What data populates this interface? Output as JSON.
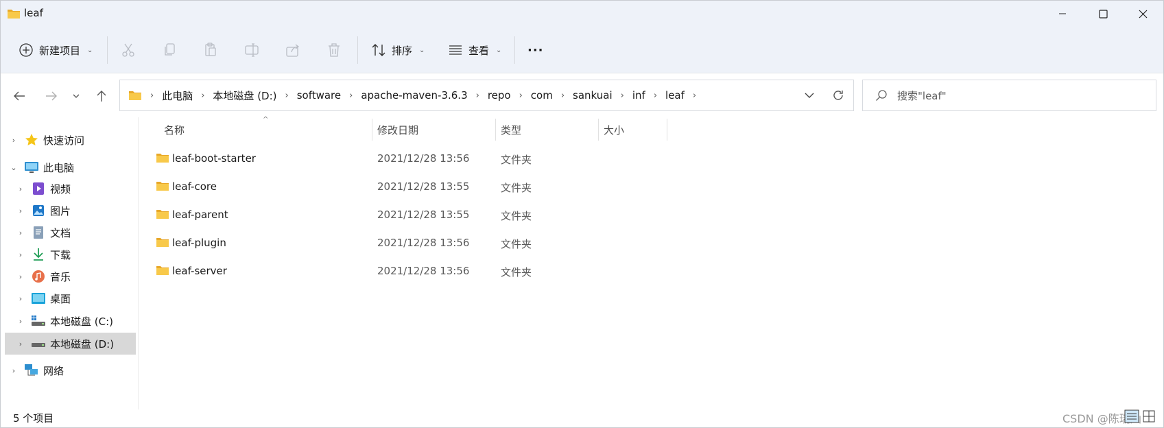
{
  "window": {
    "title": "leaf"
  },
  "toolbar": {
    "new_item": "新建项目",
    "sort": "排序",
    "view": "查看",
    "more": "···"
  },
  "address": {
    "breadcrumbs": [
      "此电脑",
      "本地磁盘 (D:)",
      "software",
      "apache-maven-3.6.3",
      "repo",
      "com",
      "sankuai",
      "inf",
      "leaf"
    ]
  },
  "search": {
    "placeholder": "搜索\"leaf\""
  },
  "sidebar": {
    "items": [
      {
        "label": "快速访问",
        "icon": "star-icon"
      },
      {
        "label": "此电脑",
        "icon": "monitor-icon"
      },
      {
        "label": "视频",
        "icon": "video-icon"
      },
      {
        "label": "图片",
        "icon": "picture-icon"
      },
      {
        "label": "文档",
        "icon": "document-icon"
      },
      {
        "label": "下载",
        "icon": "download-icon"
      },
      {
        "label": "音乐",
        "icon": "music-icon"
      },
      {
        "label": "桌面",
        "icon": "desktop-icon"
      },
      {
        "label": "本地磁盘 (C:)",
        "icon": "drive-c-icon"
      },
      {
        "label": "本地磁盘 (D:)",
        "icon": "drive-d-icon"
      },
      {
        "label": "网络",
        "icon": "network-icon"
      }
    ]
  },
  "columns": {
    "name": "名称",
    "modified": "修改日期",
    "type": "类型",
    "size": "大小"
  },
  "files": [
    {
      "name": "leaf-boot-starter",
      "modified": "2021/12/28 13:56",
      "type": "文件夹"
    },
    {
      "name": "leaf-core",
      "modified": "2021/12/28 13:55",
      "type": "文件夹"
    },
    {
      "name": "leaf-parent",
      "modified": "2021/12/28 13:55",
      "type": "文件夹"
    },
    {
      "name": "leaf-plugin",
      "modified": "2021/12/28 13:56",
      "type": "文件夹"
    },
    {
      "name": "leaf-server",
      "modified": "2021/12/28 13:56",
      "type": "文件夹"
    }
  ],
  "status": {
    "count": "5 个项目"
  },
  "watermark": "CSDN @陈瑞灿",
  "colors": {
    "folder": "#f8c94a",
    "folder_dark": "#e8a829",
    "selected": "#d8d8d8",
    "chrome": "#eef2f9"
  }
}
